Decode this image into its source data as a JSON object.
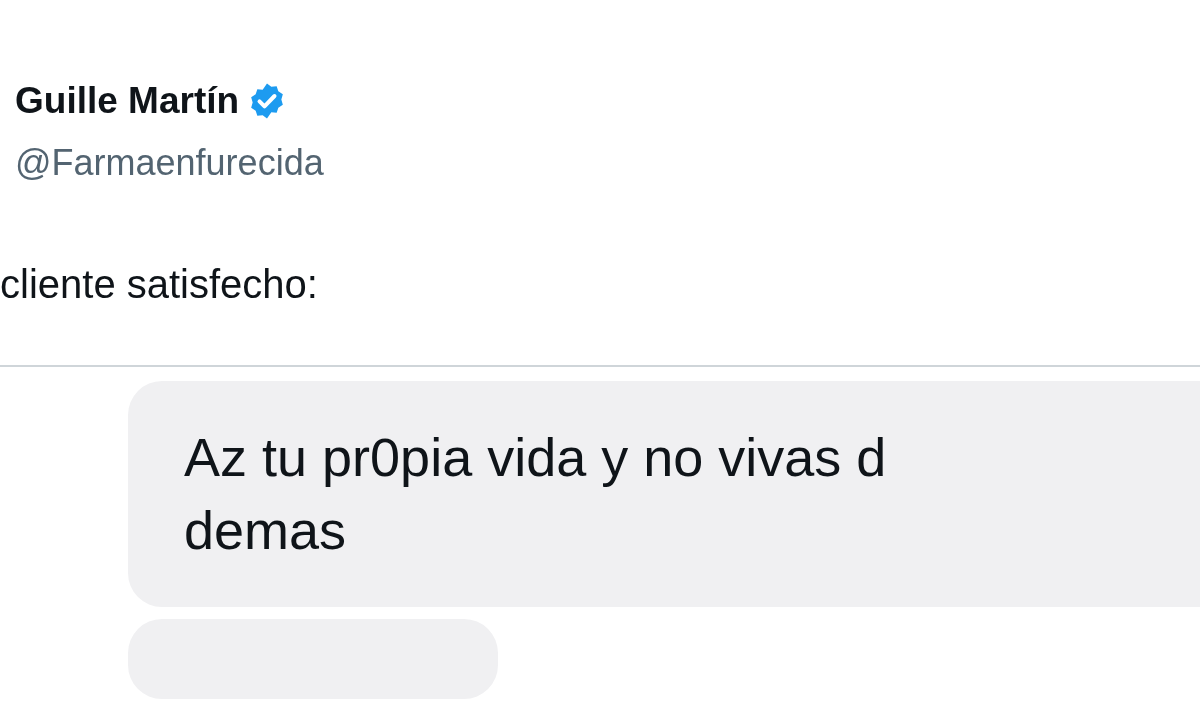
{
  "author": {
    "name": "Guille Martín",
    "verified": true,
    "handle": "@Farmaenfurecida"
  },
  "tweet_text": "cliente satisfecho:",
  "messages": [
    {
      "kind": "text",
      "lines": [
        "Az tu pr0pia vida y no vivas d",
        "demas"
      ]
    },
    {
      "kind": "cut"
    }
  ]
}
